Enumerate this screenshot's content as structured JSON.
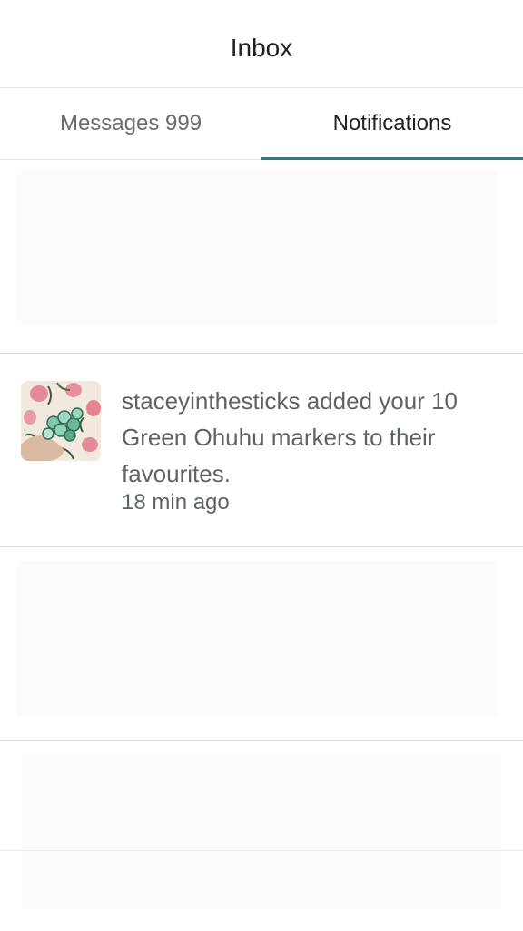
{
  "header": {
    "title": "Inbox"
  },
  "tabs": [
    {
      "label": "Messages 999",
      "active": false
    },
    {
      "label": "Notifications",
      "active": true
    }
  ],
  "accent_color": "#1e7f8c",
  "notifications": [
    {
      "text": "staceyinthesticks added your 10 Green Ohuhu markers to their favourites.",
      "time": "18 min ago",
      "thumbnail": "markers-photo"
    }
  ]
}
